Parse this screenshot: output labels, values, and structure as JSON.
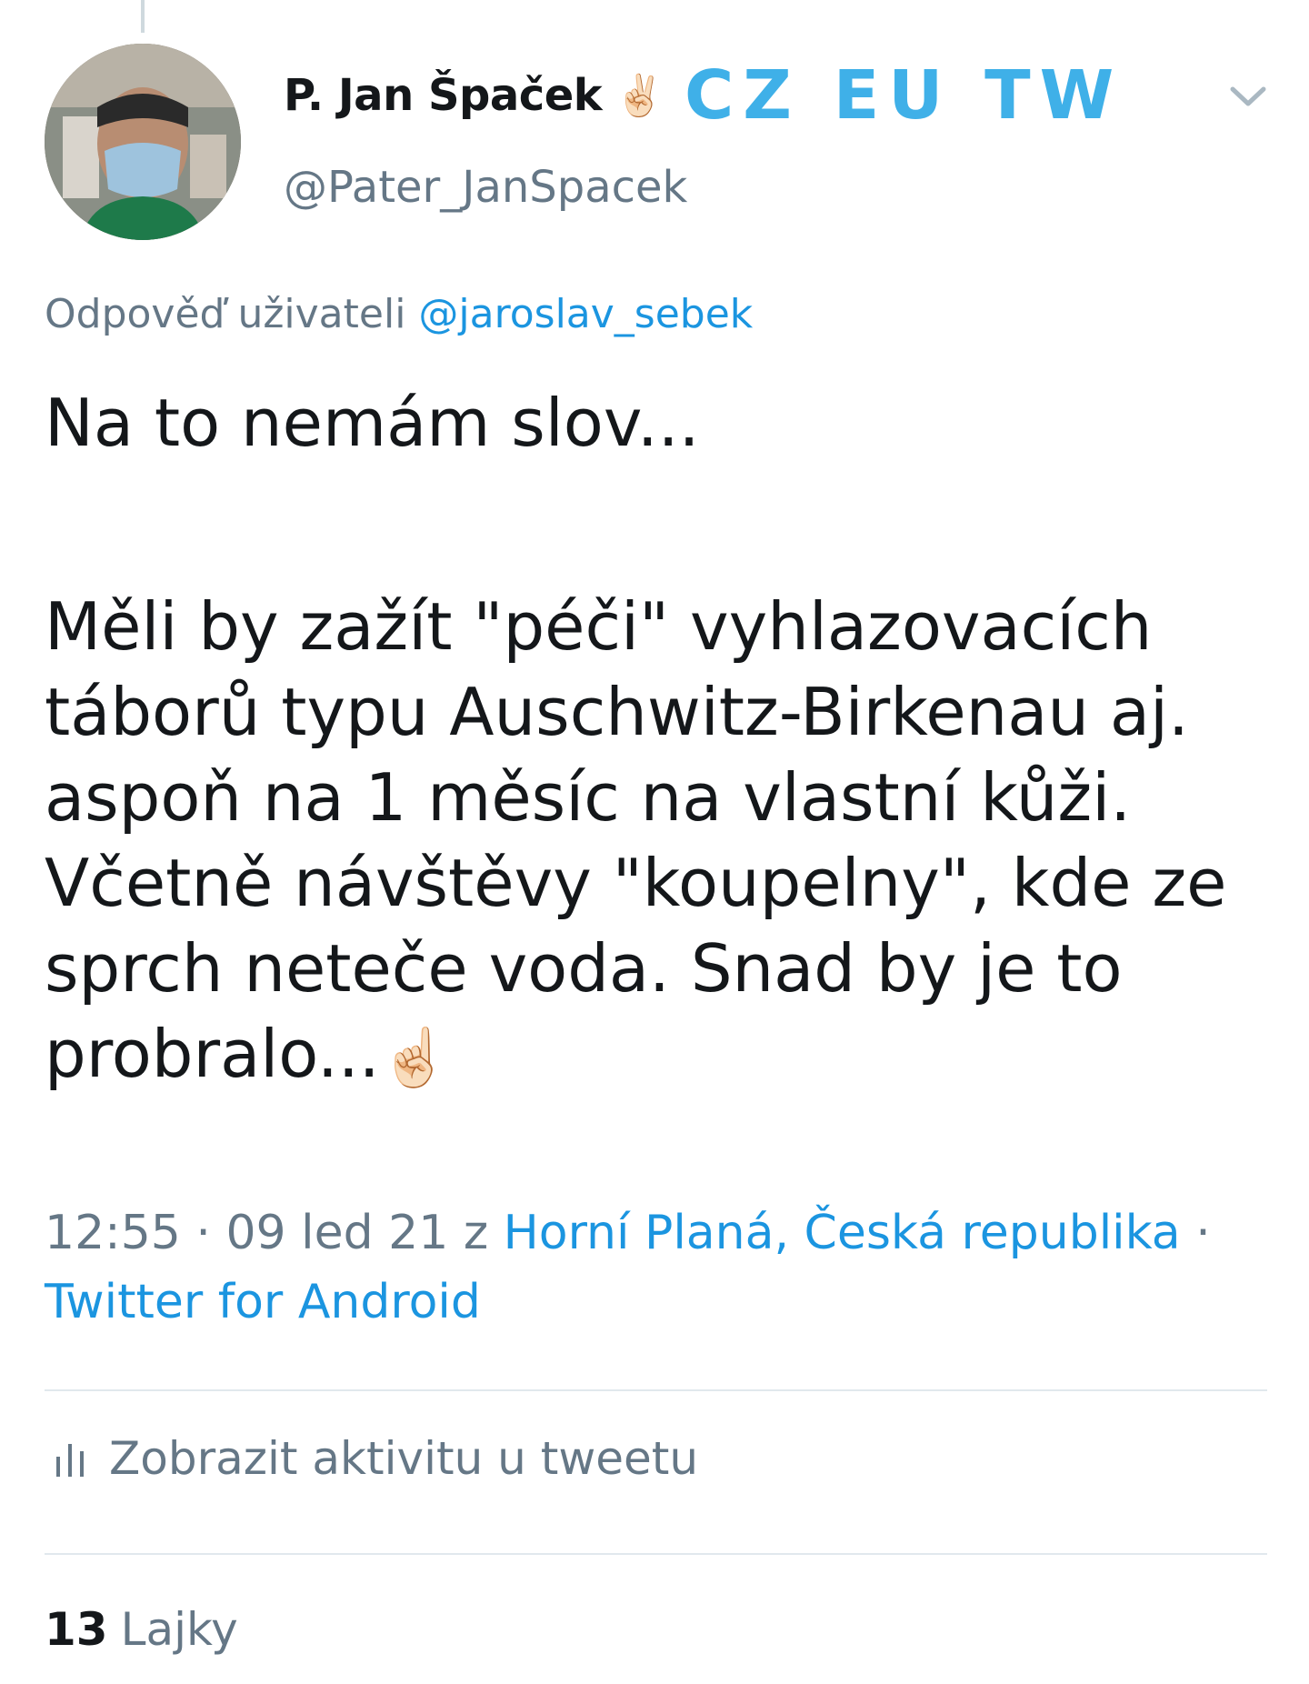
{
  "tweet": {
    "author_name": "P. Jan Špaček",
    "name_emoji": "✌🏻",
    "name_tag": "CZ EU TW",
    "handle": "@Pater_JanSpacek",
    "reply_prefix": "Odpověď uživateli",
    "reply_to": "@jaroslav_sebek",
    "text_line1": "Na to nemám slov...",
    "text_para2": "Měli by zažít \"péči\" vyhlazovacích táborů typu Auschwitz-Birkenau aj. aspoň na 1 měsíc na vlastní kůži. Včetně návštěvy \"koupelny\", kde ze sprch neteče voda. Snad by je to probralo...",
    "text_emoji": "☝🏻",
    "time": "12:55",
    "date": "09 led 21",
    "location_prefix": "z",
    "location": "Horní Planá, Česká republika",
    "source": "Twitter for Android",
    "separator": "·"
  },
  "activity": {
    "label": "Zobrazit aktivitu u tweetu",
    "icon": "analytics-bars-icon"
  },
  "likes": {
    "count": "13",
    "label": "Lajky"
  },
  "colors": {
    "link": "#1b95e0",
    "muted": "#657786",
    "tag": "#3fb0e8",
    "divider": "#e1e8ed"
  }
}
